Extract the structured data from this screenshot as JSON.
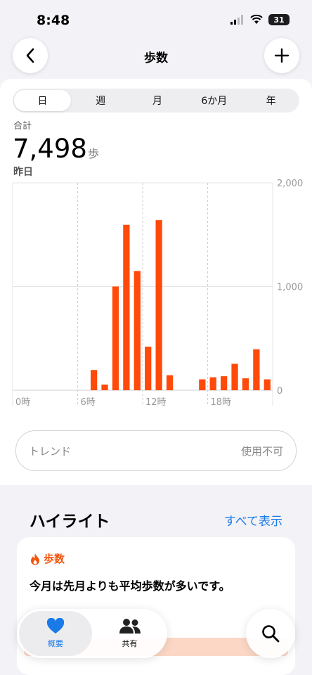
{
  "status": {
    "time": "8:48",
    "battery": "31"
  },
  "nav": {
    "title": "歩数"
  },
  "segments": [
    "日",
    "週",
    "月",
    "6か月",
    "年"
  ],
  "summary": {
    "label": "合計",
    "value": "7,498",
    "unit": "歩",
    "period": "昨日"
  },
  "chart_data": {
    "type": "bar",
    "x_labels": [
      "0時",
      "6時",
      "12時",
      "18時"
    ],
    "y_labels": [
      "2,000",
      "1,000",
      "0"
    ],
    "ylim": [
      0,
      2000
    ],
    "hours": [
      0,
      1,
      2,
      3,
      4,
      5,
      6,
      7,
      8,
      9,
      10,
      11,
      12,
      13,
      14,
      15,
      16,
      17,
      18,
      19,
      20,
      21,
      22,
      23
    ],
    "values": [
      0,
      0,
      0,
      0,
      0,
      0,
      0,
      195,
      55,
      1000,
      1595,
      1150,
      420,
      1640,
      145,
      0,
      0,
      105,
      125,
      135,
      255,
      115,
      395,
      105
    ],
    "color": "#ff4a0a",
    "grid": true
  },
  "trend": {
    "label": "トレンド",
    "value": "使用不可"
  },
  "highlights": {
    "title": "ハイライト",
    "show_all": "すべて表示",
    "card": {
      "tag": "歩数",
      "text": "今月は先月よりも平均歩数が多いです。"
    }
  },
  "tabbar": {
    "overview": "概要",
    "sharing": "共有"
  },
  "colors": {
    "accent": "#1a7ae8",
    "bar": "#ff4a0a",
    "tag": "#f2540d"
  }
}
